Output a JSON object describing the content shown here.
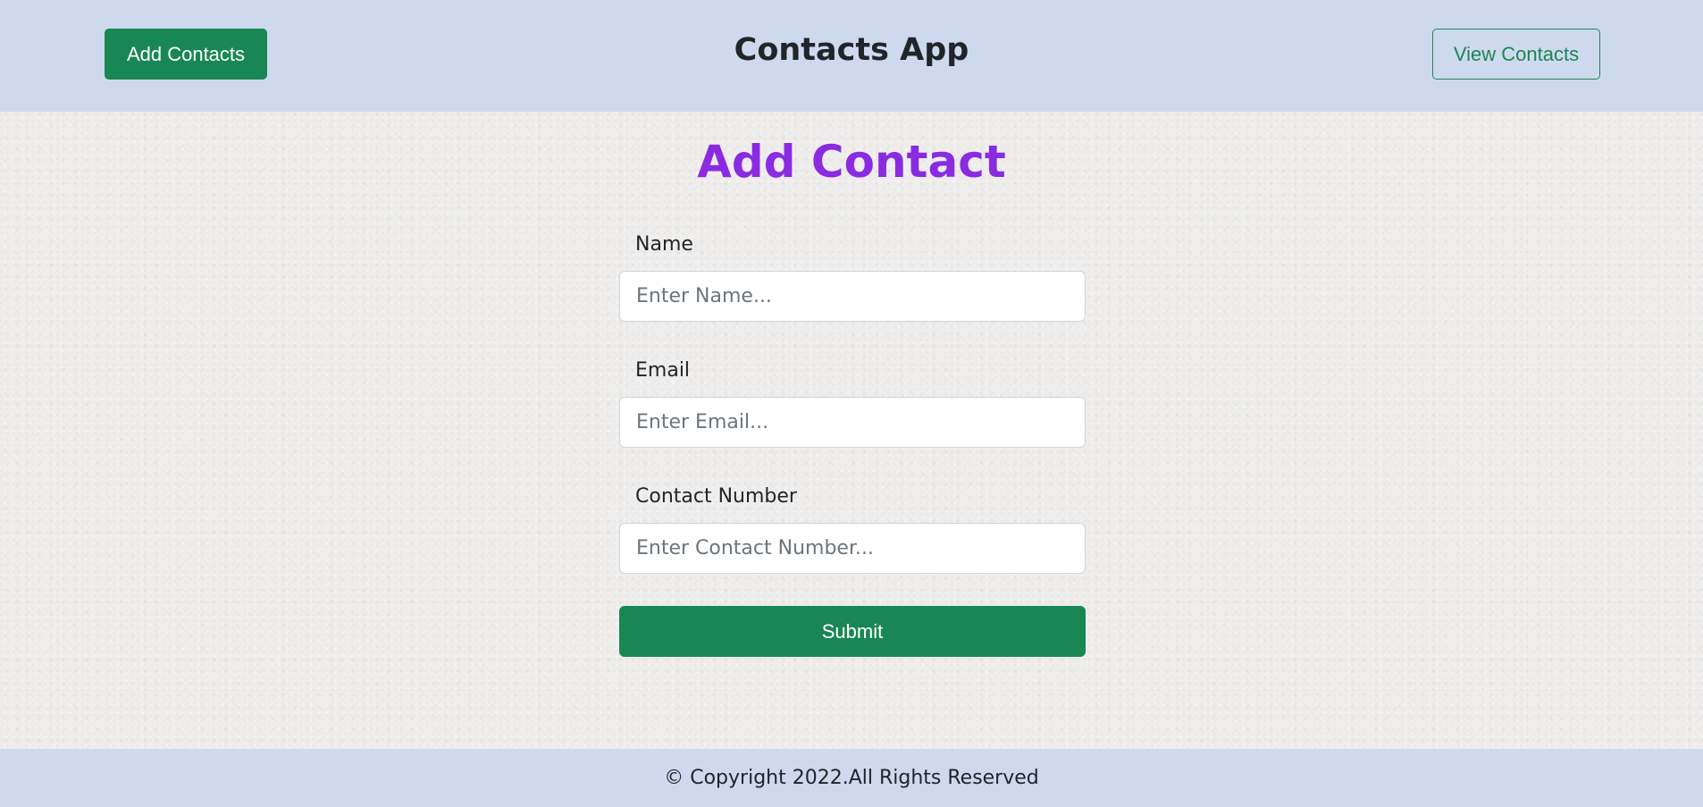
{
  "header": {
    "add_contacts_label": "Add Contacts",
    "app_title": "Contacts App",
    "view_contacts_label": "View Contacts"
  },
  "main": {
    "heading": "Add Contact",
    "fields": [
      {
        "label": "Name",
        "placeholder": "Enter Name...",
        "value": ""
      },
      {
        "label": "Email",
        "placeholder": "Enter Email...",
        "value": ""
      },
      {
        "label": "Contact Number",
        "placeholder": "Enter Contact Number...",
        "value": ""
      }
    ],
    "submit_label": "Submit"
  },
  "footer": {
    "copyright": "© Copyright 2022.All Rights Reserved"
  },
  "colors": {
    "header_bg": "#cfd9ee",
    "primary_green": "#198754",
    "heading_purple": "#8a2be2"
  }
}
